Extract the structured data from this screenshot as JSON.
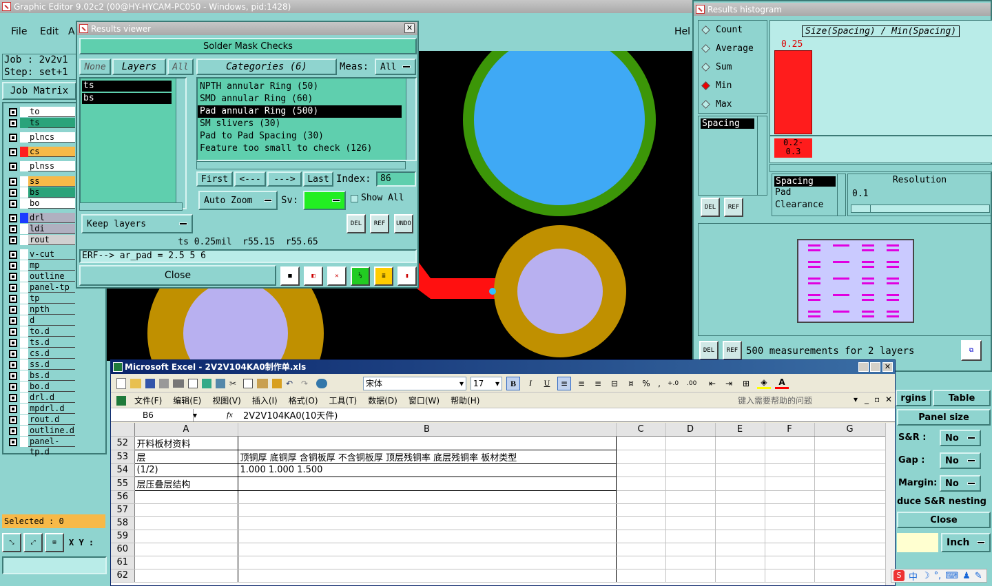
{
  "main": {
    "title": "Graphic Editor 9.02c2 (00@HY-HYCAM-PC050 - Windows, pid:1428)",
    "menu": [
      "File",
      "Edit",
      "A"
    ],
    "help": "Hel",
    "job_label": "Job :",
    "job_value": "2v2v1",
    "step_label": "Step:",
    "step_value": "set+1",
    "job_matrix": "Job Matrix",
    "selected_label": "Selected : 0",
    "xy_label": "X Y :"
  },
  "layers": [
    {
      "name": "to",
      "color": "#ffffff",
      "name_bg": "#ffffff"
    },
    {
      "name": "ts",
      "color": "#2aa37a",
      "name_bg": "#2aa37a"
    },
    {
      "name": "plncs",
      "color": "#ffffff",
      "name_bg": "#ffffff"
    },
    {
      "name": "cs",
      "color": "#ff2020",
      "name_bg": "#f7b948"
    },
    {
      "name": "plnss",
      "color": "#ffffff",
      "name_bg": "#ffffff"
    },
    {
      "name": "ss",
      "color": "#ffffff",
      "name_bg": "#f7b948"
    },
    {
      "name": "bs",
      "color": "#ffffff",
      "name_bg": "#2aa37a"
    },
    {
      "name": "bo",
      "color": "#ffffff",
      "name_bg": "#ffffff"
    },
    {
      "name": "drl",
      "color": "#1c3bff",
      "name_bg": "#b0b0c0"
    },
    {
      "name": "ldi",
      "color": "#ffffff",
      "name_bg": "#b0b0c0"
    },
    {
      "name": "rout",
      "color": "#ffffff",
      "name_bg": "#d0d0d0"
    },
    {
      "name": "v-cut",
      "color": "#ffffff",
      "name_bg": "#8fd4cf"
    },
    {
      "name": "mp",
      "color": "#ffffff",
      "name_bg": "#8fd4cf"
    },
    {
      "name": "outline",
      "color": "#ffffff",
      "name_bg": "#8fd4cf"
    },
    {
      "name": "panel-tp",
      "color": "#ffffff",
      "name_bg": "#8fd4cf"
    },
    {
      "name": "tp",
      "color": "#ffffff",
      "name_bg": "#8fd4cf"
    },
    {
      "name": "npth",
      "color": "#ffffff",
      "name_bg": "#8fd4cf"
    },
    {
      "name": "d",
      "color": "#ffffff",
      "name_bg": "#8fd4cf"
    },
    {
      "name": "to.d",
      "color": "#ffffff",
      "name_bg": "#8fd4cf"
    },
    {
      "name": "ts.d",
      "color": "#ffffff",
      "name_bg": "#8fd4cf"
    },
    {
      "name": "cs.d",
      "color": "#ffffff",
      "name_bg": "#8fd4cf"
    },
    {
      "name": "ss.d",
      "color": "#ffffff",
      "name_bg": "#8fd4cf"
    },
    {
      "name": "bs.d",
      "color": "#ffffff",
      "name_bg": "#8fd4cf"
    },
    {
      "name": "bo.d",
      "color": "#ffffff",
      "name_bg": "#8fd4cf"
    },
    {
      "name": "drl.d",
      "color": "#ffffff",
      "name_bg": "#8fd4cf"
    },
    {
      "name": "mpdrl.d",
      "color": "#ffffff",
      "name_bg": "#8fd4cf"
    },
    {
      "name": "rout.d",
      "color": "#ffffff",
      "name_bg": "#8fd4cf"
    },
    {
      "name": "outline.d",
      "color": "#ffffff",
      "name_bg": "#8fd4cf"
    },
    {
      "name": "panel-tp.d",
      "color": "#ffffff",
      "name_bg": "#8fd4cf"
    }
  ],
  "viewer": {
    "title": "Results viewer",
    "header": "Solder Mask Checks",
    "none": "None",
    "layers": "Layers",
    "all": "All",
    "layer_list": [
      "ts",
      "bs"
    ],
    "categories": "Categories (6)",
    "meas_label": "Meas:",
    "meas_value": "All",
    "category_list": [
      "NPTH annular Ring (50)",
      "SMD annular Ring (60)",
      "Pad annular Ring (500)",
      "SM slivers (30)",
      "Pad to Pad Spacing (30)",
      "Feature too small to check (126)"
    ],
    "selected_category": 2,
    "first": "First",
    "prev": "<---",
    "next": "--->",
    "last": "Last",
    "index_label": "Index:",
    "index_value": "86",
    "auto_zoom": "Auto Zoom",
    "sv_label": "Sv:",
    "show_all": "Show All",
    "keep_layers": "Keep layers",
    "del": "DEL",
    "ref": "REF",
    "undo": "UNDO",
    "status1": "ts 0.25mil  r55.15  r55.65",
    "status2": "ERF--> ar_pad = 2.5 5 6",
    "close": "Close"
  },
  "histogram": {
    "title": "Results histogram",
    "options": [
      "Count",
      "Average",
      "Sum",
      "Min",
      "Max"
    ],
    "selected_option": "Min",
    "chart_title": "Size(Spacing) / Min(Spacing)",
    "bar_value": "0.25",
    "bar_range": "0.2-\n0.3",
    "list_left": [
      "Spacing"
    ],
    "list_mid": [
      "Spacing",
      "Pad",
      "Clearance"
    ],
    "resolution_label": "Resolution",
    "resolution_value": "0.1",
    "del": "DEL",
    "ref": "REF",
    "measurements": "500 measurements for 2 layers"
  },
  "right_panel": {
    "margins": "rgins",
    "table": "Table",
    "panel_size": "Panel size",
    "sr_label": "S&R :",
    "sr_value": "No",
    "gap_label": "Gap :",
    "gap_value": "No",
    "margin_label": "Margin:",
    "margin_value": "No",
    "reduce": "duce S&R nesting",
    "close": "Close",
    "unit": "Inch"
  },
  "excel": {
    "title": "Microsoft Excel - 2V2V104KA0制作单.xls",
    "font_name": "宋体",
    "font_size": "17",
    "menus": [
      "文件(F)",
      "编辑(E)",
      "视图(V)",
      "插入(I)",
      "格式(O)",
      "工具(T)",
      "数据(D)",
      "窗口(W)",
      "帮助(H)"
    ],
    "help_placeholder": "键入需要帮助的问题",
    "cell_ref": "B6",
    "fx": "fx",
    "formula": "2V2V104KA0(10天件)",
    "columns": [
      "A",
      "B",
      "C",
      "D",
      "E",
      "F",
      "G"
    ],
    "rows": [
      {
        "n": "52",
        "a": "开料板材资料",
        "b": ""
      },
      {
        "n": "53",
        "a": "层",
        "b": "顶铜厚  底铜厚  含铜板厚  不含铜板厚  顶层残铜率  底层残铜率  板材类型"
      },
      {
        "n": "54",
        "a": "(1/2)",
        "b": "1.000   1.000    1.500"
      },
      {
        "n": "55",
        "a": "层压叠层结构",
        "b": ""
      },
      {
        "n": "56",
        "a": "",
        "b": ""
      },
      {
        "n": "57",
        "a": "",
        "b": ""
      },
      {
        "n": "58",
        "a": "",
        "b": ""
      },
      {
        "n": "59",
        "a": "",
        "b": ""
      },
      {
        "n": "60",
        "a": "",
        "b": ""
      },
      {
        "n": "61",
        "a": "",
        "b": ""
      },
      {
        "n": "62",
        "a": "",
        "b": ""
      }
    ],
    "ime": "中"
  }
}
